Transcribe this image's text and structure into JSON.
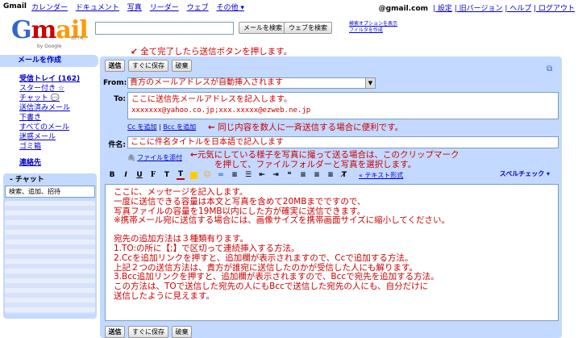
{
  "topbar": {
    "brand": "Gmail",
    "nav": [
      "カレンダー",
      "ドキュメント",
      "写真",
      "リーダー",
      "ウェブ",
      "その他 ▾"
    ],
    "email": "@gmail.com",
    "links": [
      "| 設定",
      "| 旧バージョン",
      "| ヘルプ",
      "| ログアウト"
    ]
  },
  "logo": {
    "g1": "G",
    "g2": "m",
    "g3": "ail",
    "beta": "BETA",
    "by": "by Google"
  },
  "search": {
    "mail_button": "メールを検索",
    "web_button": "ウェブを検索",
    "options_line1": "検索オプションを表示",
    "options_line2": "フィルタを作成"
  },
  "sidebar": {
    "compose": "メールを作成",
    "items": [
      "受信トレイ (162)",
      "スター付き ☆",
      "チャット 💬",
      "送信済みメール",
      "下書き",
      "すべてのメール",
      "迷惑メール",
      "ゴミ箱"
    ],
    "contacts": "連絡先",
    "chat_header": "- チャット",
    "chat_search": "検索、追加、招待"
  },
  "compose": {
    "send": "送信",
    "save": "すぐに保存",
    "discard": "破棄",
    "from_label": "From:",
    "from_value": "貴方のメールアドレスが自動挿入されます",
    "to_label": "To:",
    "to_line1": "ここに送信先メールアドレスを記入します。",
    "to_line2": "xxxxxxx@yahoo.co.jp;xxx.xxxxx@ezweb.ne.jp",
    "cc_link": "Cc を追加",
    "separator": " | ",
    "bcc_link": "Bcc を追加",
    "subject_label": "件名:",
    "subject_value": "ここに件名タイトルを日本語で記入します",
    "attach_link": "ファイルを添付",
    "richtext_link": "« テキスト形式",
    "spellcheck": "スペルチェック ▾",
    "body": [
      "ここに、メッセージを記入します。",
      "一度に送信できる容量は本文と写真を含めて20MBまでですので、",
      "写真ファイルの容量を19MB以内にした方が確実に送信できます。",
      "※携帯メール宛に送信する場合には、画像サイズを携帯画面サイズに縮小してください。",
      "",
      "宛先の追加方法は３種類有ります。",
      "1.TO:の所に【;】で区切って連続挿入する方法。",
      "2.Ccを追加リンクを押すと、追加欄が表示されますので、Ccで追加する方法。",
      "上記２つの送信方法は、貴方が誰宛に送信したのかが受信した人にも解ります。",
      "3.Bcc追加リンクを押すと、追加欄が表示されますので、Bccで宛先を追加する方法。",
      "この方法は、TOで送信した宛先の人にもBccで送信した宛先の人にも、自分だけに",
      "送信したように見えます。"
    ]
  },
  "annotations": {
    "send_note": "全て完了したら送信ボタンを押します。",
    "cc_note": "同じ内容を数人に一斉送信する場合に便利です。",
    "attach_note_1": "元気にしている様子を写真に撮って送る場合は、このクリップマーク",
    "attach_note_2": "を押して、ファイルフォルダーと写真を選択します。"
  },
  "colors": {
    "accent": "#c3d9ff",
    "link": "#0000cc",
    "annotation": "#cc0000"
  }
}
